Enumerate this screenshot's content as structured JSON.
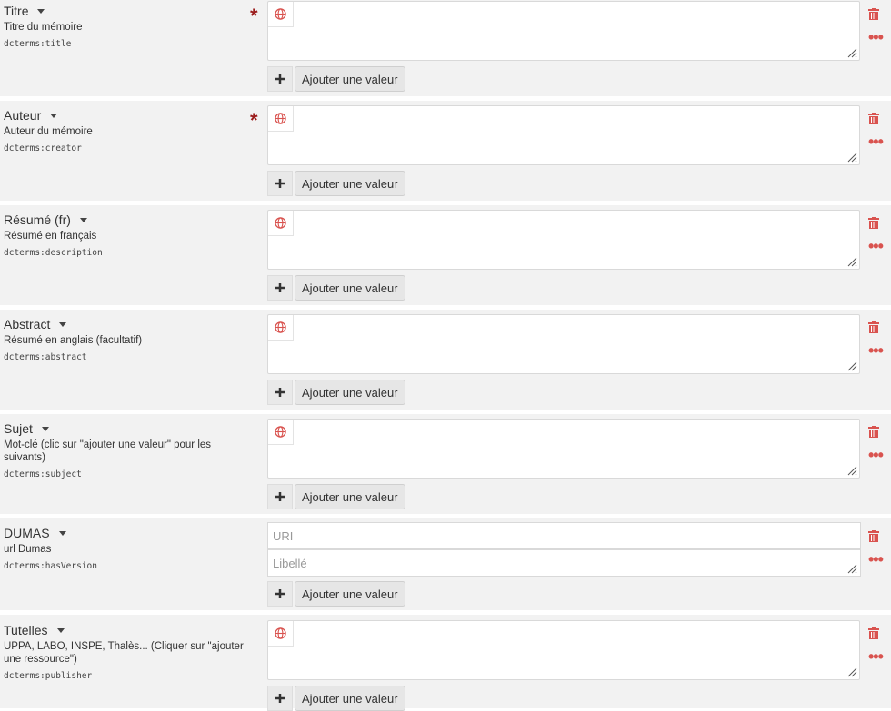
{
  "actions": {
    "add_value_label": "Ajouter une valeur"
  },
  "fields": [
    {
      "title": "Titre",
      "desc": "Titre du mémoire",
      "term": "dcterms:title"
    },
    {
      "title": "Auteur",
      "desc": "Auteur du mémoire",
      "term": "dcterms:creator"
    },
    {
      "title": "Résumé (fr)",
      "desc": "Résumé en français",
      "term": "dcterms:description"
    },
    {
      "title": "Abstract",
      "desc": "Résumé en anglais (facultatif)",
      "term": "dcterms:abstract"
    },
    {
      "title": "Sujet",
      "desc": "Mot-clé (clic sur \"ajouter une valeur\" pour les suivants)",
      "term": "dcterms:subject"
    },
    {
      "title": "DUMAS",
      "desc": "url Dumas",
      "term": "dcterms:hasVersion",
      "uri_placeholder": "URI",
      "label_placeholder": "Libellé"
    },
    {
      "title": "Tutelles",
      "desc": "UPPA, LABO, INSPE, Thalès... (Cliquer sur \"ajouter une ressource\")",
      "term": "dcterms:publisher"
    }
  ],
  "required_marker": "*",
  "colors": {
    "required": "#9b1c1c",
    "danger": "#d9534f",
    "panel": "#f2f2f2"
  },
  "icons": {
    "language": "globe-icon",
    "delete": "trash-icon",
    "options": "ellipsis-icon",
    "add": "plus-icon",
    "menu": "caret-down-icon",
    "resize": "resize-grip-icon"
  }
}
